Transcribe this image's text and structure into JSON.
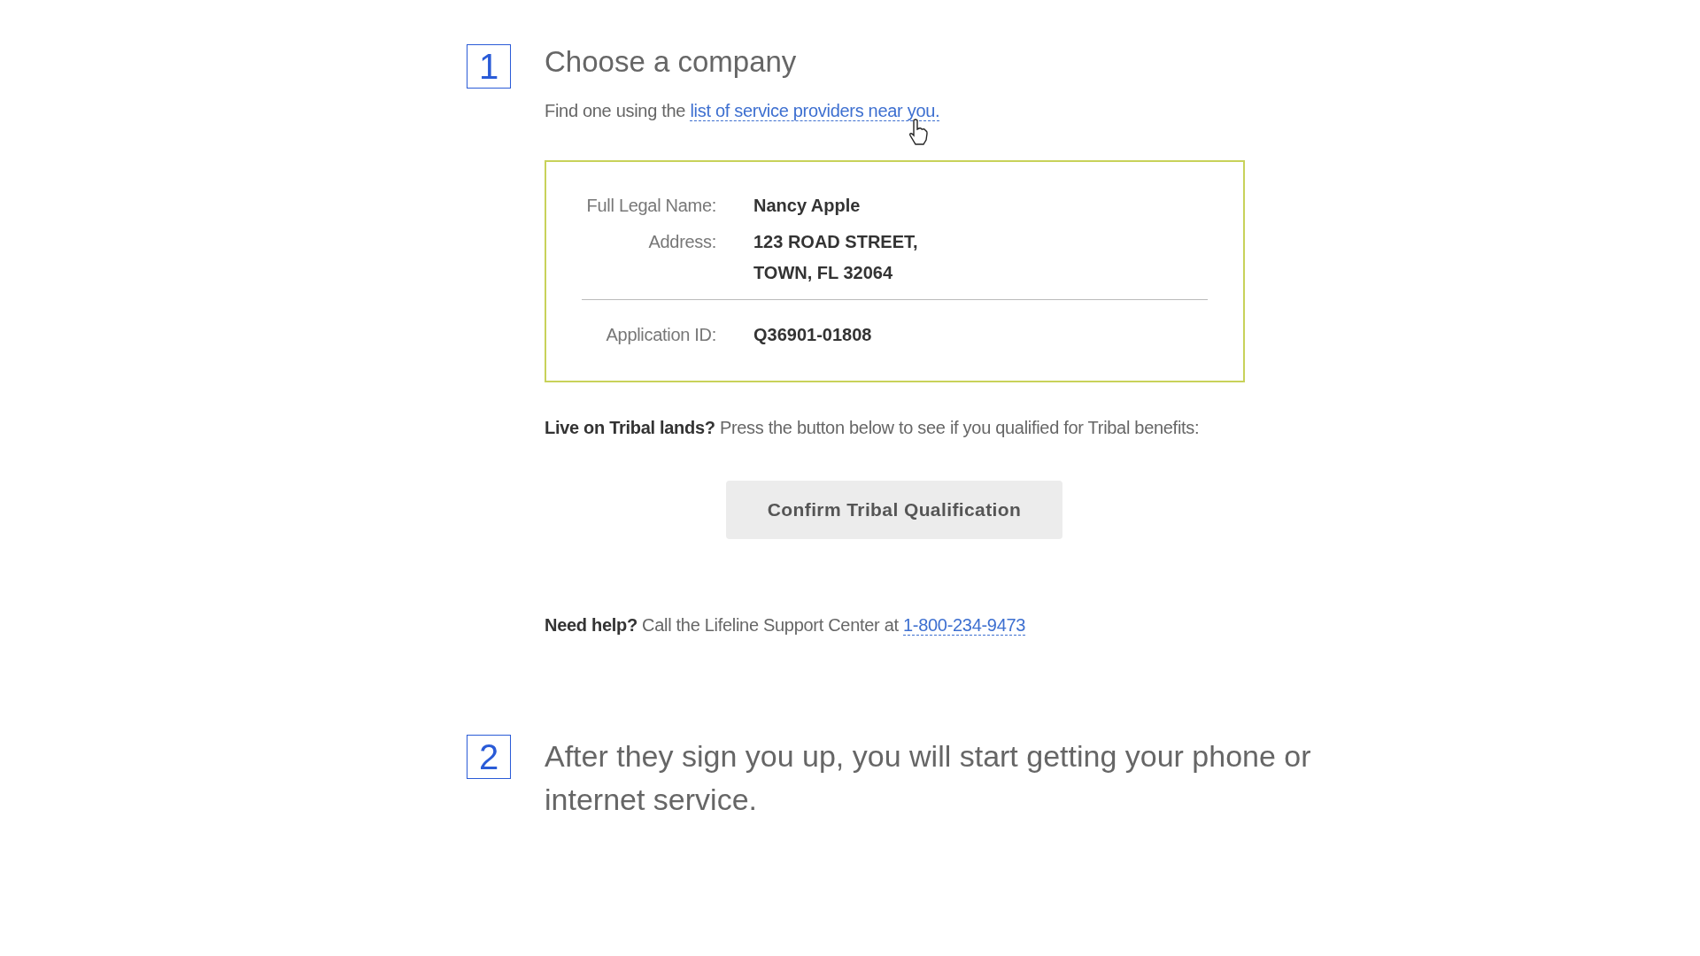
{
  "step_1": {
    "number": "1",
    "title": "Choose a company",
    "intro": "Find one using the",
    "intro_link": "list of service providers near you."
  },
  "details": {
    "groups": [
      [
        {
          "label": "Full Legal Name:",
          "values": [
            "Nancy Apple"
          ]
        },
        {
          "label": "Address:",
          "values": [
            "123 ROAD STREET,",
            "TOWN, FL 32064"
          ]
        }
      ],
      [
        {
          "label": "Application ID:",
          "values": [
            "Q36901-01808"
          ]
        }
      ]
    ]
  },
  "tribal": {
    "text": "**Live on Tribal lands?** Press the button below to see if you qualified for Tribal benefits:",
    "button": "Confirm Tribal Qualification"
  },
  "help": {
    "text": "**Need help?** Call the Lifeline Support Center at",
    "link": "1-800-234-9473"
  },
  "step_2": {
    "number": "2",
    "title": "After they sign you up, you will start getting your phone or internet service."
  }
}
